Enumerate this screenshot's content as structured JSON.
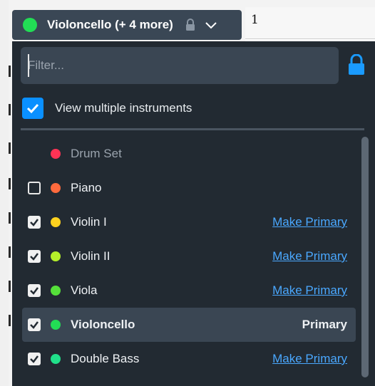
{
  "score": {
    "measure_number": "1"
  },
  "selector": {
    "label": "Violoncello (+ 4 more)",
    "dot_color": "#22dd55",
    "lock_icon": "lock-icon",
    "chevron_icon": "chevron-down-icon"
  },
  "filter": {
    "placeholder": "Filter...",
    "value": ""
  },
  "lock_button": {
    "icon": "lock-icon",
    "color": "#1a9bff"
  },
  "view_multiple": {
    "label": "View multiple instruments",
    "checked": true
  },
  "instruments": [
    {
      "name": "Drum Set",
      "color": "#ff3355",
      "check": "none",
      "action": "",
      "disabled": true
    },
    {
      "name": "Piano",
      "color": "#ff6a3d",
      "check": "unchecked",
      "action": ""
    },
    {
      "name": "Violin I",
      "color": "#ffd21f",
      "check": "checked",
      "action": "Make Primary"
    },
    {
      "name": "Violin II",
      "color": "#b4ef2a",
      "check": "checked",
      "action": "Make Primary"
    },
    {
      "name": "Viola",
      "color": "#55e03a",
      "check": "checked",
      "action": "Make Primary"
    },
    {
      "name": "Violoncello",
      "color": "#22dd55",
      "check": "checked",
      "action": "Primary",
      "selected": true
    },
    {
      "name": "Double Bass",
      "color": "#20e08a",
      "check": "checked",
      "action": "Make Primary"
    }
  ]
}
